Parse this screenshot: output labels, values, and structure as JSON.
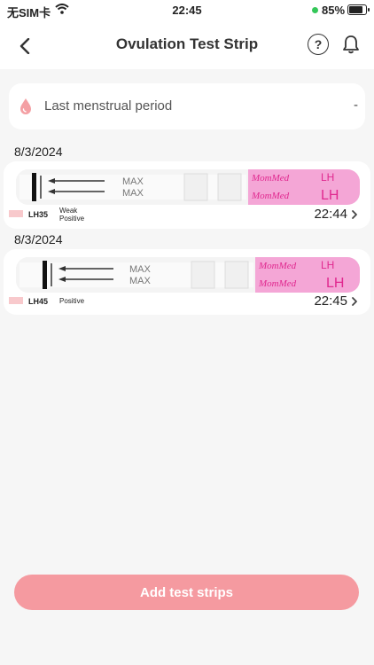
{
  "status_bar": {
    "carrier": "无SIM卡",
    "time": "22:45",
    "battery": "85%"
  },
  "nav": {
    "title": "Ovulation Test Strip"
  },
  "lmp": {
    "label": "Last menstrual period",
    "value": "-"
  },
  "records": [
    {
      "date": "8/3/2024",
      "lh": "LH35",
      "result_line1": "Weak",
      "result_line2": "Positive",
      "time": "22:44"
    },
    {
      "date": "8/3/2024",
      "lh": "LH45",
      "result_line1": "Positive",
      "result_line2": "",
      "time": "22:45"
    }
  ],
  "strip_text": {
    "max": "MAX",
    "brand": "MomMed",
    "lh": "LH"
  },
  "add_button": {
    "label": "Add test strips"
  },
  "colors": {
    "accent": "#f59aa0",
    "swatch": "#f8c9cc",
    "strip_pink": "#f4a6d6"
  }
}
